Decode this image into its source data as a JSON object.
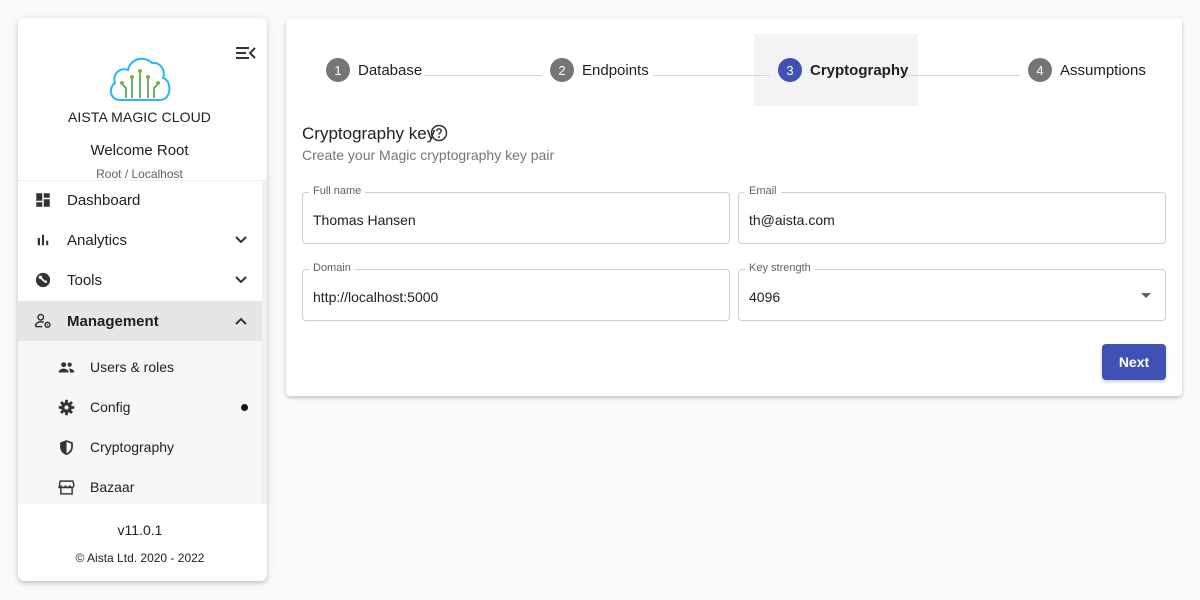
{
  "sidebar": {
    "brand": "AISTA MAGIC CLOUD",
    "welcome": "Welcome Root",
    "environment": "Root / Localhost",
    "nav": [
      {
        "label": "Dashboard",
        "icon": "dashboard-icon"
      },
      {
        "label": "Analytics",
        "icon": "bar-chart-icon",
        "expanded": false
      },
      {
        "label": "Tools",
        "icon": "tools-icon",
        "expanded": false
      },
      {
        "label": "Management",
        "icon": "manage-accounts-icon",
        "expanded": true,
        "active": true
      }
    ],
    "subnav": [
      {
        "label": "Users & roles",
        "icon": "people-icon"
      },
      {
        "label": "Config",
        "icon": "gear-icon",
        "badge_dot": true
      },
      {
        "label": "Cryptography",
        "icon": "shield-icon"
      },
      {
        "label": "Bazaar",
        "icon": "store-icon"
      }
    ],
    "version": "v11.0.1",
    "copyright": "© Aista Ltd. 2020 - 2022"
  },
  "stepper": {
    "active_step": 3,
    "steps": [
      {
        "number": "1",
        "label": "Database"
      },
      {
        "number": "2",
        "label": "Endpoints"
      },
      {
        "number": "3",
        "label": "Cryptography"
      },
      {
        "number": "4",
        "label": "Assumptions"
      }
    ]
  },
  "form": {
    "title": "Cryptography key",
    "description": "Create your Magic cryptography key pair",
    "fields": {
      "full_name": {
        "label": "Full name",
        "value": "Thomas Hansen"
      },
      "email": {
        "label": "Email",
        "value": "th@aista.com"
      },
      "domain": {
        "label": "Domain",
        "value": "http://localhost:5000"
      },
      "key_strength": {
        "label": "Key strength",
        "value": "4096"
      }
    },
    "next_label": "Next"
  },
  "colors": {
    "accent": "#3f51b5",
    "step_inactive": "#757575",
    "active_nav_bg": "#e6e6e6",
    "logo": "#29b6f6"
  }
}
